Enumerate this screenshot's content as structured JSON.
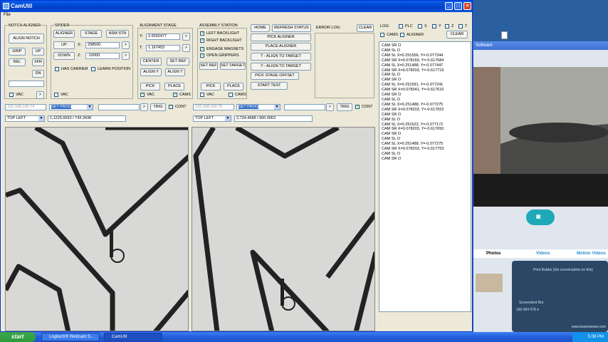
{
  "window": {
    "title": "CamUtil",
    "menu": "File"
  },
  "notch": {
    "title": "NOTCH ALIGNER",
    "align": "ALIGN NOTCH",
    "grip": "GRIP",
    "up": "UP",
    "rel": "REL",
    "xfr": "XFR",
    "dn": "DN",
    "vac": "VAC",
    "arrow": ">"
  },
  "spider": {
    "title": "SPIDER",
    "aligner": "ALIGNER",
    "stage": "STAGE",
    "asm": "ASM STN",
    "up": "UP",
    "down": "DOWN",
    "x_label": "X:",
    "x_val": "298500.",
    "z_label": "Z:",
    "z_val": "-10000.",
    "has_carrier": "HAS CARRIER",
    "learn": "LEARN POSITION",
    "vac": "VAC",
    "arrow": ">"
  },
  "align_stage": {
    "title": "ALIGNMENT STAGE",
    "y_label": "Y:",
    "y_val": "2.6592477",
    "t_label": "T:",
    "t_val": "1.167453",
    "center": "CENTER",
    "set_ref": "SET REF",
    "align_y": "ALIGN Y",
    "align_t": "ALIGN T",
    "pick": "PICK",
    "place": "PLACE",
    "vac": "VAC",
    "cams": "CAMS",
    "arrow": ">"
  },
  "assembly": {
    "title": "ASSEMBLY STATION",
    "left_bl": "LEFT BACKLIGHT",
    "right_bl": "RIGHT BACKLIGHT",
    "engage": "ENGAGE MAGNETS",
    "open": "OPEN GRIPPERS",
    "set_ref": "SET REF",
    "set_target": "SET TARGET",
    "pick": "PICK",
    "place": "PLACE",
    "vac": "VAC",
    "cams": "CAMS"
  },
  "commands": {
    "home": "HOME",
    "refresh": "REFRESH STATUS",
    "pick_aligner": "PICK ALIGNER",
    "place_aligner": "PLACE ALIGNER",
    "t_align": "T - ALIGN TO TARGET",
    "y_align": "Y - ALIGN TO TARGET",
    "pick_offset": "PICK STAGE OFFSET",
    "start": "START TEST"
  },
  "error": {
    "title": "ERROR LOG:",
    "clear": "CLEAR"
  },
  "log": {
    "title": "LOG:",
    "plc": "PLC",
    "x": "X",
    "y": "Y",
    "z": "Z",
    "t": "T",
    "cams": "CAMS",
    "aligner": "ALIGNER",
    "clear": "CLEAR",
    "lines": [
      "CAM SR O",
      "CAM SL O",
      "CAM SL X=0.251556, Y=-0.077344",
      "CAM SR X=0.078169, Y=-0.617684",
      "CAM SL X=0.251488, Y=-0.077447",
      "CAM SR X=0.078203, Y=-0.617719",
      "CAM SL O",
      "CAM SR O",
      "CAM SL X=0.251591, Y=-0.077241",
      "CAM SR X=0.078341, Y=-0.617616",
      "CAM SR O",
      "CAM SL O",
      "CAM SL X=0.251488, Y=-0.077275",
      "CAM SR X=0.078203, Y=-0.617822",
      "CAM SR O",
      "CAM SL O",
      "CAM SL X=0.251522, Y=-0.077172",
      "CAM SR X=0.078203, Y=-0.617650",
      "CAM SR O",
      "CAM SL O",
      "CAM SL X=0.251488, Y=-0.077275",
      "CAM SR X=0.078203, Y=-0.617753",
      "CAM SL O",
      "CAM SR O"
    ]
  },
  "camleft": {
    "ip": "192.168.100.74",
    "prog": "SET PROG",
    "arrow": ">",
    "trig": "TRIG",
    "cont": "CONT",
    "origin": "TOP LEFT",
    "coords": "1,1225.6563 / 743.3438"
  },
  "camright": {
    "ip": "192.168.100.75",
    "prog": "SET PROG",
    "arrow": ">",
    "trig": "TRIG",
    "cont": "CONT",
    "origin": "TOP LEFT",
    "coords": "2,734.4688 / 900.9063"
  },
  "side": {
    "title": "Software",
    "photos": "Photos",
    "videos": "Videos",
    "motion": "Motion Videos",
    "chat1": "Print Bubba (Sin conversation on this)",
    "chat2": "Screenshot Bot",
    "chat3": "160 554 078 ▾",
    "site": "www.teamviewer.com"
  },
  "taskbar": {
    "start": "start",
    "t1": "Logitech® Webcam S...",
    "t2": "CamUtil",
    "clock": "5:08 PM"
  }
}
